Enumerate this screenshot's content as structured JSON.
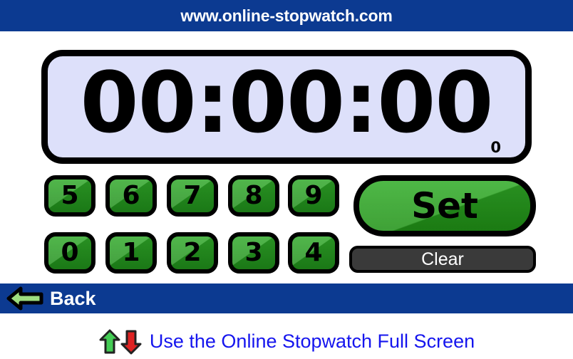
{
  "header": {
    "title": "www.online-stopwatch.com",
    "background_color": "#0c3a91",
    "text_color": "#ffffff"
  },
  "display": {
    "time": "00:00:00",
    "subdigit": "0",
    "panel_background": "#dde0fa",
    "border_color": "#000000"
  },
  "numpad": {
    "button_color": "#2fa828",
    "rows": [
      {
        "keys": [
          {
            "label": "5",
            "name": "key-5"
          },
          {
            "label": "6",
            "name": "key-6"
          },
          {
            "label": "7",
            "name": "key-7"
          },
          {
            "label": "8",
            "name": "key-8"
          },
          {
            "label": "9",
            "name": "key-9"
          }
        ]
      },
      {
        "keys": [
          {
            "label": "0",
            "name": "key-0"
          },
          {
            "label": "1",
            "name": "key-1"
          },
          {
            "label": "2",
            "name": "key-2"
          },
          {
            "label": "3",
            "name": "key-3"
          },
          {
            "label": "4",
            "name": "key-4"
          }
        ]
      }
    ]
  },
  "actions": {
    "set_label": "Set",
    "set_color": "#31ac28",
    "clear_label": "Clear",
    "clear_color": "#3a3a3a"
  },
  "back": {
    "label": "Back",
    "icon": "arrow-left-icon",
    "arrow_fill": "#9ede80",
    "background_color": "#0c3a91"
  },
  "footer": {
    "link_text": "Use the Online Stopwatch Full Screen",
    "link_color": "#1515ee",
    "up_icon": "arrow-up-icon",
    "down_icon": "arrow-down-icon",
    "up_color": "#44cc55",
    "down_color": "#dd2222"
  }
}
